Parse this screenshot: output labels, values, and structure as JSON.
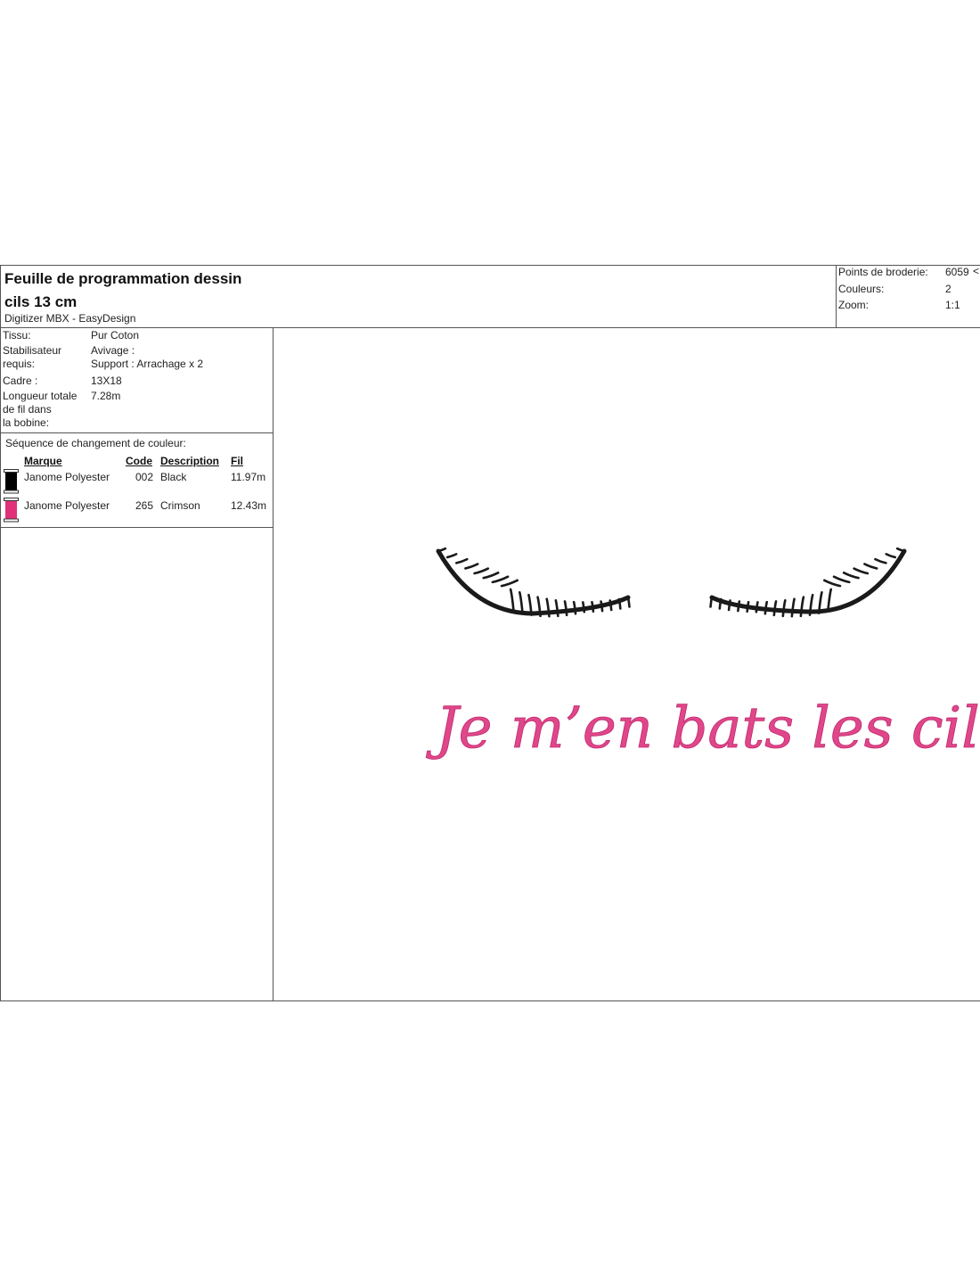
{
  "header": {
    "title_line1": "Feuille de programmation dessin",
    "title_line2": "cils 13 cm",
    "software": "Digitizer MBX - EasyDesign"
  },
  "stats": {
    "stitches_label": "Points de broderie:",
    "stitches_value": "6059",
    "stitches_arrow": "<",
    "colors_label": "Couleurs:",
    "colors_value": "2",
    "zoom_label": "Zoom:",
    "zoom_value": "1:1"
  },
  "info": {
    "fabric_label": "Tissu:",
    "fabric_value": "Pur Coton",
    "stabilizer_label_1": "Stabilisateur",
    "stabilizer_label_2": "requis:",
    "stabilizer_value_1": "Avivage :",
    "stabilizer_value_2": "Support : Arrachage x 2",
    "frame_label": "Cadre :",
    "frame_value": "13X18",
    "thread_length_label_1": "Longueur totale",
    "thread_length_label_2": "de fil dans",
    "thread_length_label_3": "la bobine:",
    "thread_length_value": "7.28m"
  },
  "color_sequence": {
    "title": "Séquence de changement de couleur:",
    "headers": {
      "brand": "Marque",
      "code": "Code",
      "description": "Description",
      "thread": "Fil"
    },
    "threads": [
      {
        "brand": "Janome Polyester",
        "code": "002",
        "description": "Black",
        "length": "11.97m",
        "color": "#000000"
      },
      {
        "brand": "Janome Polyester",
        "code": "265",
        "description": "Crimson",
        "length": "12.43m",
        "color": "#e0307a"
      }
    ]
  },
  "design": {
    "text": "Je m’en bats les cils",
    "text_color": "#e0468a",
    "lash_color": "#1a1a1a"
  }
}
